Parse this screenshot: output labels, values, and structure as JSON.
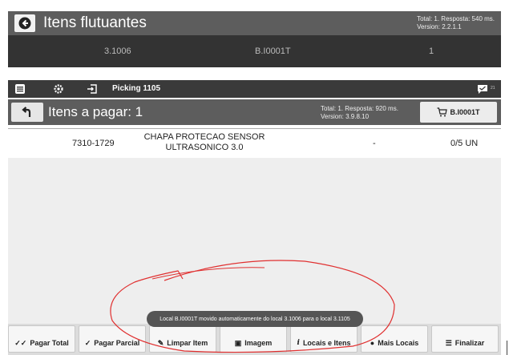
{
  "top_panel": {
    "title": "Itens flutuantes",
    "stats_line1": "Total: 1. Resposta: 540 ms.",
    "stats_line2": "Version: 2.2.1.1",
    "row": {
      "location": "3.1006",
      "code": "B.I0001T",
      "qty": "1"
    }
  },
  "toolbar": {
    "title": "Picking 1105",
    "badge": "21"
  },
  "subheader": {
    "title": "Itens a pagar: 1",
    "stats_line1": "Total: 1. Resposta: 920 ms.",
    "stats_line2": "Version: 3.9.8.10",
    "location_button": "B.I0001T"
  },
  "item": {
    "code": "7310-1729",
    "description_line1": "CHAPA PROTECAO SENSOR",
    "description_line2": "ULTRASONICO 3.0",
    "lot": "-",
    "qty": "0/5 UN"
  },
  "toast": "Local B.I0001T movido automaticamente do local 3.1006 para o local 3.1105",
  "footer": {
    "pagar_total": "Pagar Total",
    "pagar_parcial": "Pagar Parcial",
    "limpar_item": "Limpar Item",
    "imagem": "Imagem",
    "locais_itens": "Locais e Itens",
    "mais_locais": "Mais Locais",
    "finalizar": "Finalizar"
  },
  "colors": {
    "header": "#5d5d5d",
    "toolbar": "#3a3a3a",
    "row_dark": "#333333",
    "annotation": "#e03030"
  }
}
